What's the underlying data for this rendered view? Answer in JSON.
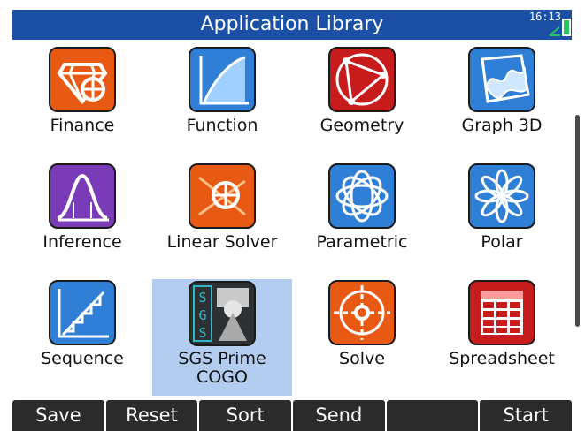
{
  "title": "Application Library",
  "status": {
    "time": "16:13"
  },
  "partial_label_above": "...",
  "apps": [
    {
      "label": "Finance",
      "icon": "finance-icon",
      "color": "#e85a14",
      "selected": false
    },
    {
      "label": "Function",
      "icon": "function-icon",
      "color": "#2f7fd6",
      "selected": false
    },
    {
      "label": "Geometry",
      "icon": "geometry-icon",
      "color": "#c81c1c",
      "selected": false
    },
    {
      "label": "Graph 3D",
      "icon": "graph-3d-icon",
      "color": "#2f7fd6",
      "selected": false
    },
    {
      "label": "Inference",
      "icon": "inference-icon",
      "color": "#7a3bb8",
      "selected": false
    },
    {
      "label": "Linear Solver",
      "icon": "linear-solver-icon",
      "color": "#e85a14",
      "selected": false
    },
    {
      "label": "Parametric",
      "icon": "parametric-icon",
      "color": "#2f7fd6",
      "selected": false
    },
    {
      "label": "Polar",
      "icon": "polar-icon",
      "color": "#2f7fd6",
      "selected": false
    },
    {
      "label": "Sequence",
      "icon": "sequence-icon",
      "color": "#2f7fd6",
      "selected": false
    },
    {
      "label": "SGS Prime COGO",
      "icon": "sgs-prime-cogo-icon",
      "color": "#2e3134",
      "selected": true
    },
    {
      "label": "Solve",
      "icon": "solve-icon",
      "color": "#e85a14",
      "selected": false
    },
    {
      "label": "Spreadsheet",
      "icon": "spreadsheet-icon",
      "color": "#c81c1c",
      "selected": false
    }
  ],
  "menu": [
    "Save",
    "Reset",
    "Sort",
    "Send",
    "",
    "Start"
  ]
}
